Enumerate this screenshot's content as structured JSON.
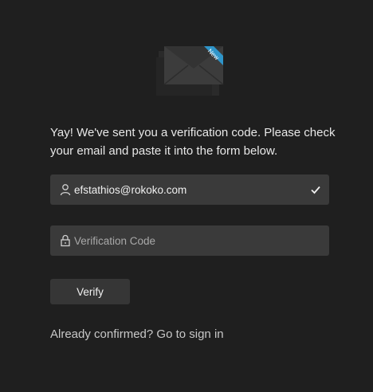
{
  "envelope": {
    "badge_text": "New",
    "badge_color": "#2f95c9",
    "icon": "envelope-icon"
  },
  "message": "Yay! We've sent you a verification code. Please check your email and paste it into the form below.",
  "email_field": {
    "value": "efstathios@rokoko.com",
    "icon": "user-icon",
    "status_icon": "checkmark-icon"
  },
  "code_field": {
    "value": "",
    "placeholder": "Verification Code",
    "icon": "lock-icon"
  },
  "verify_button": {
    "label": "Verify"
  },
  "signin": {
    "prompt": "Already confirmed?",
    "link_label": "Go to sign in"
  }
}
